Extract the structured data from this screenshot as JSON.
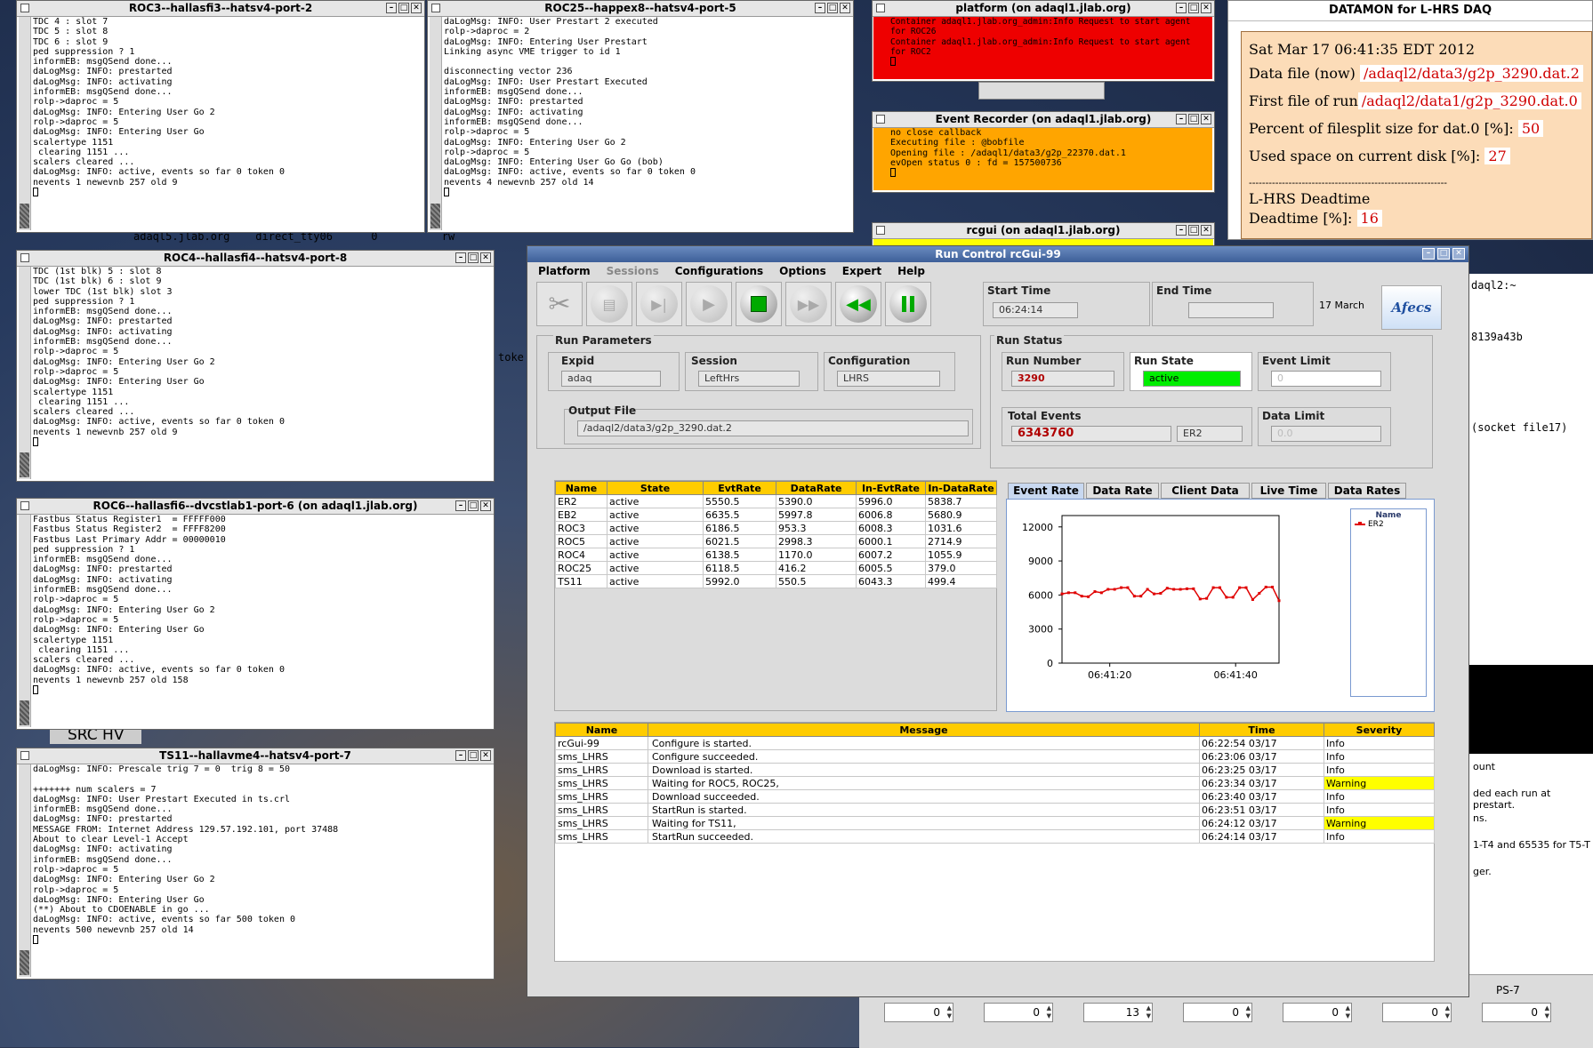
{
  "roc3": {
    "title": "ROC3--hallasfi3--hatsv4-port-2",
    "lines": [
      "TDC 4 : slot 7",
      "TDC 5 : slot 8",
      "TDC 6 : slot 9",
      "ped suppression ? 1",
      "informEB: msgQSend done...",
      "daLogMsg: INFO: prestarted",
      "daLogMsg: INFO: activating",
      "informEB: msgQSend done...",
      "rolp->daproc = 5",
      "daLogMsg: INFO: Entering User Go 2",
      "rolp->daproc = 5",
      "daLogMsg: INFO: Entering User Go",
      "scalertype 1151",
      " clearing 1151 ...",
      "scalers cleared ...",
      "daLogMsg: INFO: active, events so far 0 token 0",
      "nevents 1 newevnb 257 old 9"
    ]
  },
  "roc25": {
    "title": "ROC25--happex8--hatsv4-port-5",
    "lines": [
      "daLogMsg: INFO: User Prestart 2 executed",
      "rolp->daproc = 2",
      "daLogMsg: INFO: Entering User Prestart",
      "Linking async VME trigger to id 1",
      "",
      "disconnecting vector 236",
      "daLogMsg: INFO: User Prestart Executed",
      "informEB: msgQSend done...",
      "daLogMsg: INFO: prestarted",
      "daLogMsg: INFO: activating",
      "informEB: msgQSend done...",
      "rolp->daproc = 5",
      "daLogMsg: INFO: Entering User Go 2",
      "rolp->daproc = 5",
      "daLogMsg: INFO: Entering User Go Go (bob)",
      "daLogMsg: INFO: active, events so far 0 token 0",
      "nevents 4 newevnb 257 old 14"
    ]
  },
  "roc4": {
    "title": "ROC4--hallasfi4--hatsv4-port-8",
    "lines": [
      "TDC (1st blk) 5 : slot 8",
      "TDC (1st blk) 6 : slot 9",
      "lower TDC (1st blk) slot 3",
      "ped suppression ? 1",
      "informEB: msgQSend done...",
      "daLogMsg: INFO: prestarted",
      "daLogMsg: INFO: activating",
      "informEB: msgQSend done...",
      "rolp->daproc = 5",
      "daLogMsg: INFO: Entering User Go 2",
      "rolp->daproc = 5",
      "daLogMsg: INFO: Entering User Go",
      "scalertype 1151",
      " clearing 1151 ...",
      "scalers cleared ...",
      "daLogMsg: INFO: active, events so far 0 token 0",
      "nevents 1 newevnb 257 old 9"
    ]
  },
  "roc6": {
    "title": "ROC6--hallasfi6--dvcstlab1-port-6 (on adaql1.jlab.org)",
    "lines": [
      "Fastbus Status Register1  = FFFFF000",
      "Fastbus Status Register2  = FFFF8200",
      "Fastbus Last Primary Addr = 00000010",
      "ped suppression ? 1",
      "informEB: msgQSend done...",
      "daLogMsg: INFO: prestarted",
      "daLogMsg: INFO: activating",
      "informEB: msgQSend done...",
      "rolp->daproc = 5",
      "daLogMsg: INFO: Entering User Go 2",
      "rolp->daproc = 5",
      "daLogMsg: INFO: Entering User Go",
      "scalertype 1151",
      " clearing 1151 ...",
      "scalers cleared ...",
      "daLogMsg: INFO: active, events so far 0 token 0",
      "nevents 1 newevnb 257 old 158"
    ]
  },
  "ts11": {
    "title": "TS11--hallavme4--hatsv4-port-7",
    "lines": [
      "daLogMsg: INFO: Prescale trig 7 = 0  trig 8 = 50",
      "",
      "+++++++ num scalers = 7",
      "daLogMsg: INFO: User Prestart Executed in ts.crl",
      "informEB: msgQSend done...",
      "daLogMsg: INFO: prestarted",
      "MESSAGE FROM: Internet Address 129.57.192.101, port 37488",
      "About to clear Level-1 Accept",
      "daLogMsg: INFO: activating",
      "informEB: msgQSend done...",
      "rolp->daproc = 5",
      "daLogMsg: INFO: Entering User Go 2",
      "rolp->daproc = 5",
      "daLogMsg: INFO: Entering User Go",
      "(**) About to CDOENABLE in go ...",
      "daLogMsg: INFO: active, events so far 500 token 0",
      "nevents 500 newevnb 257 old 14"
    ]
  },
  "platform": {
    "title": "platform (on adaql1.jlab.org)",
    "lines": [
      "Container adaql1.jlab.org_admin:Info Request to start agent",
      "for ROC26",
      "Container adaql1.jlab.org_admin:Info Request to start agent",
      "for ROC2"
    ]
  },
  "recorder": {
    "title": "Event Recorder (on adaql1.jlab.org)",
    "lines": [
      "no close callback",
      "Executing file : @bobfile",
      "Opening file : /adaql1/data3/g2p_22370.dat.1",
      "evOpen status 0 : fd = 157500736"
    ]
  },
  "rcgui_term": {
    "title": "rcgui (on adaql1.jlab.org)"
  },
  "background": {
    "frag1": "adaql5.jlab.org    direct_tty06      0          rw",
    "frag2": "toke",
    "frag3": "SRC HV",
    "frag4": "daql2:~",
    "frag5": "8139a43b",
    "frag6": "(socket file17)",
    "frag7": "ount",
    "frag8": "ded each run at prestart.",
    "frag9": "ns.",
    "frag10": "1-T4 and 65535 for T5-T",
    "frag11": "ger.",
    "ps_label": "PS-7",
    "spinners": [
      "0",
      "0",
      "13",
      "0",
      "0",
      "0",
      "0"
    ]
  },
  "datamon": {
    "title": "DATAMON  for L-HRS DAQ",
    "date": "Sat Mar 17 06:41:35 EDT 2012",
    "datafile_label": "Data file (now)",
    "datafile": "/adaql2/data3/g2p_3290.dat.2",
    "firstfile_label": "First file of run",
    "firstfile": "/adaql2/data1/g2p_3290.dat.0",
    "percent_label": "Percent of filesplit size for dat.0 [%]:",
    "percent": "50",
    "used_label": "Used space on current disk [%]:",
    "used": "27",
    "separator": "------------------------------------------------------------",
    "deadtime_title": "L-HRS Deadtime",
    "deadtime_label": "Deadtime [%]:",
    "deadtime": "16"
  },
  "rc": {
    "title": "Run Control rcGui-99",
    "menu": [
      "Platform",
      "Sessions",
      "Configurations",
      "Options",
      "Expert",
      "Help"
    ],
    "start_time_label": "Start Time",
    "start_time": "06:24:14",
    "end_time_label": "End Time",
    "end_time": "",
    "date": "17 March",
    "logo": "Afecs",
    "run_params_title": "Run Parameters",
    "expid_label": "Expid",
    "expid": "adaq",
    "session_label": "Session",
    "session": "LeftHrs",
    "config_label": "Configuration",
    "config": "LHRS",
    "output_label": "Output File",
    "output": "/adaql2/data3/g2p_3290.dat.2",
    "run_status_title": "Run Status",
    "run_number_label": "Run Number",
    "run_number": "3290",
    "run_state_label": "Run State",
    "run_state": "active",
    "event_limit_label": "Event Limit",
    "event_limit": "0",
    "total_events_label": "Total Events",
    "total_events": "6343760",
    "total_events_comp": "ER2",
    "data_limit_label": "Data Limit",
    "data_limit": "0.0",
    "comp_headers": [
      "Name",
      "State",
      "EvtRate",
      "DataRate",
      "In-EvtRate",
      "In-DataRate"
    ],
    "components": [
      [
        "ER2",
        "active",
        "5550.5",
        "5390.0",
        "5996.0",
        "5838.7"
      ],
      [
        "EB2",
        "active",
        "6635.5",
        "5997.8",
        "6006.8",
        "5680.9"
      ],
      [
        "ROC3",
        "active",
        "6186.5",
        "953.3",
        "6008.3",
        "1031.6"
      ],
      [
        "ROC5",
        "active",
        "6021.5",
        "2998.3",
        "6000.1",
        "2714.9"
      ],
      [
        "ROC4",
        "active",
        "6138.5",
        "1170.0",
        "6007.2",
        "1055.9"
      ],
      [
        "ROC25",
        "active",
        "6118.5",
        "416.2",
        "6005.5",
        "379.0"
      ],
      [
        "TS11",
        "active",
        "5992.0",
        "550.5",
        "6043.3",
        "499.4"
      ]
    ],
    "tabs": [
      "Event Rate",
      "Data Rate",
      "Client Data",
      "Live Time",
      "Data Rates"
    ],
    "legend_title": "Name",
    "msg_headers": [
      "Name",
      "Message",
      "Time",
      "Severity"
    ],
    "messages": [
      [
        "rcGui-99",
        "Configure is started.",
        "06:22:54 03/17",
        "Info"
      ],
      [
        "sms_LHRS",
        "Configure succeeded.",
        "06:23:06 03/17",
        "Info"
      ],
      [
        "sms_LHRS",
        "Download is started.",
        "06:23:25 03/17",
        "Info"
      ],
      [
        "sms_LHRS",
        "Waiting for ROC5, ROC25,",
        "06:23:34 03/17",
        "Warning"
      ],
      [
        "sms_LHRS",
        "Download succeeded.",
        "06:23:40 03/17",
        "Info"
      ],
      [
        "sms_LHRS",
        "StartRun is started.",
        "06:23:51 03/17",
        "Info"
      ],
      [
        "sms_LHRS",
        "Waiting for TS11,",
        "06:24:12 03/17",
        "Warning"
      ],
      [
        "sms_LHRS",
        "StartRun succeeded.",
        "06:24:14 03/17",
        "Info"
      ]
    ]
  },
  "chart_data": {
    "type": "line",
    "title": "",
    "xlabel": "",
    "ylabel": "",
    "x_tick_labels": [
      "06:41:20",
      "06:41:40"
    ],
    "y_ticks": [
      0,
      3000,
      6000,
      9000,
      12000
    ],
    "ylim": [
      0,
      13000
    ],
    "legend_placement": "right",
    "series": [
      {
        "name": "ER2",
        "color": "#e00000",
        "values": [
          6100,
          6200,
          6200,
          5900,
          5850,
          6300,
          6200,
          6500,
          6500,
          6650,
          6650,
          5900,
          5900,
          6500,
          6100,
          6150,
          6600,
          6500,
          6500,
          6550,
          6550,
          5650,
          5700,
          6650,
          6650,
          5800,
          5800,
          6650,
          6650,
          5600,
          6150,
          6700,
          6700,
          5500
        ]
      }
    ]
  }
}
